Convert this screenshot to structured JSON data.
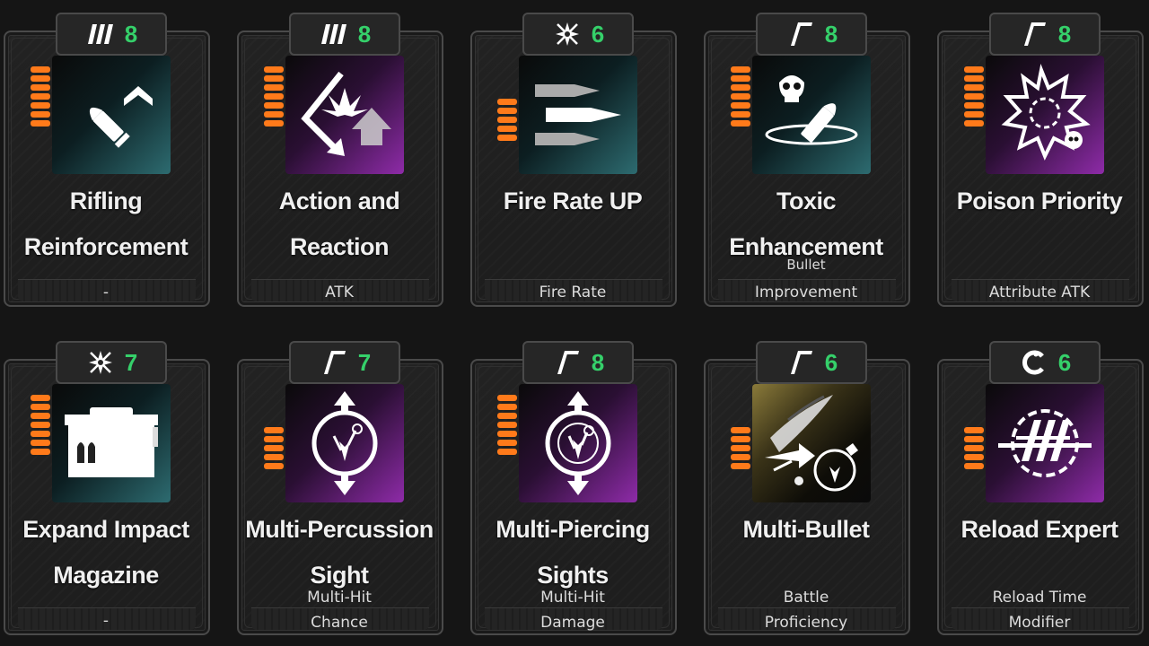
{
  "accent_cost_color": "#35d06a",
  "pip_color": "#ff7a1a",
  "cards": [
    {
      "cost_icon": "stripes-icon",
      "cost": "8",
      "bg": "teal",
      "art_icon": "bullet-upgrade-icon",
      "pips": 7,
      "name_line1": "Rifling",
      "name_line2": "Reinforcement",
      "cat_line1": "",
      "cat_line2": "-"
    },
    {
      "cost_icon": "stripes-icon",
      "cost": "8",
      "bg": "purple",
      "art_icon": "ricochet-arrow-icon",
      "pips": 7,
      "name_line1": "Action and",
      "name_line2": "Reaction",
      "cat_line1": "",
      "cat_line2": "ATK"
    },
    {
      "cost_icon": "star-cross-icon",
      "cost": "6",
      "bg": "teal",
      "art_icon": "triple-bullet-icon",
      "pips": 5,
      "name_line1": "Fire Rate UP",
      "name_line2": "",
      "cat_line1": "",
      "cat_line2": "Fire Rate"
    },
    {
      "cost_icon": "slash-gamma-icon",
      "cost": "8",
      "bg": "teal",
      "art_icon": "toxic-bullet-icon",
      "pips": 7,
      "name_line1": "Toxic",
      "name_line2": "Enhancement",
      "cat_line1": "Bullet",
      "cat_line2": "Improvement"
    },
    {
      "cost_icon": "slash-gamma-icon",
      "cost": "8",
      "bg": "purple",
      "art_icon": "poison-burst-icon",
      "pips": 7,
      "name_line1": "Poison Priority",
      "name_line2": "",
      "cat_line1": "",
      "cat_line2": "Attribute ATK"
    },
    {
      "cost_icon": "star-cross-icon",
      "cost": "7",
      "bg": "teal",
      "art_icon": "ammo-box-icon",
      "pips": 7,
      "name_line1": "Expand Impact",
      "name_line2": "Magazine",
      "cat_line1": "",
      "cat_line2": "-"
    },
    {
      "cost_icon": "slash-gamma-icon",
      "cost": "7",
      "bg": "purple",
      "art_icon": "multi-hit-circle-icon",
      "pips": 5,
      "name_line1": "Multi-Percussion",
      "name_line2": "Sight",
      "cat_line1": "Multi-Hit",
      "cat_line2": "Chance"
    },
    {
      "cost_icon": "slash-gamma-icon",
      "cost": "8",
      "bg": "purple",
      "art_icon": "multi-pierce-circle-icon",
      "pips": 7,
      "name_line1": "Multi-Piercing",
      "name_line2": "Sights",
      "cat_line1": "Multi-Hit",
      "cat_line2": "Damage"
    },
    {
      "cost_icon": "slash-gamma-icon",
      "cost": "6",
      "bg": "gold",
      "art_icon": "multi-bullet-icon",
      "pips": 5,
      "name_line1": "Multi-Bullet",
      "name_line2": "",
      "cat_line1": "Battle",
      "cat_line2": "Proficiency"
    },
    {
      "cost_icon": "reload-c-icon",
      "cost": "6",
      "bg": "purple",
      "art_icon": "reload-icon",
      "pips": 5,
      "name_line1": "Reload Expert",
      "name_line2": "",
      "cat_line1": "Reload Time",
      "cat_line2": "Modifier"
    }
  ]
}
